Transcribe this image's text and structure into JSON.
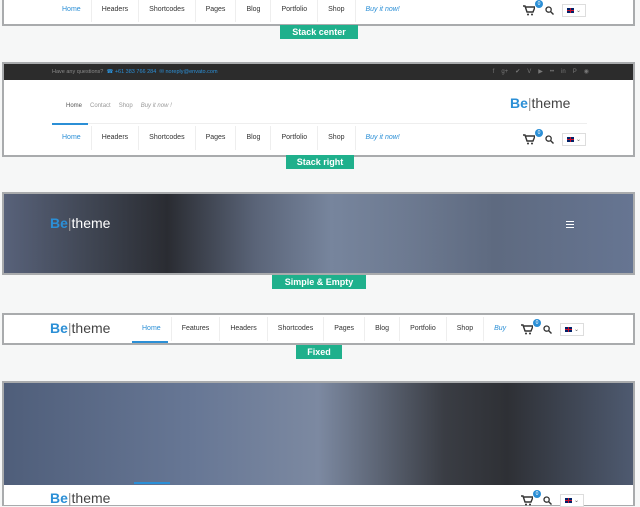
{
  "nav_main": [
    "Home",
    "Headers",
    "Shortcodes",
    "Pages",
    "Blog",
    "Portfolio",
    "Shop"
  ],
  "nav_buy": "Buy it now!",
  "nav_fixed": [
    "Home",
    "Features",
    "Headers",
    "Shortcodes",
    "Pages",
    "Blog",
    "Portfolio",
    "Shop"
  ],
  "nav_fixed_buy": "Buy",
  "cart_count": "0",
  "labels": {
    "stack_center": "Stack center",
    "stack_right": "Stack right",
    "simple_empty": "Simple & Empty",
    "fixed": "Fixed"
  },
  "topbar": {
    "question": "Have any questions?",
    "phone": "+61 383 766 284",
    "email": "noreply@envato.com",
    "social_icons": [
      "facebook",
      "google-plus",
      "twitter",
      "vimeo",
      "youtube",
      "flickr",
      "linkedin",
      "pinterest",
      "dribbble"
    ]
  },
  "logo": {
    "be": "Be",
    "theme": "theme"
  },
  "subnav": [
    "Home",
    "Contact",
    "Shop",
    "Buy it now !"
  ],
  "colors": {
    "accent": "#2b8fd6",
    "label_bg": "#1fb08c",
    "topbar_bg": "#2c2c2c"
  }
}
